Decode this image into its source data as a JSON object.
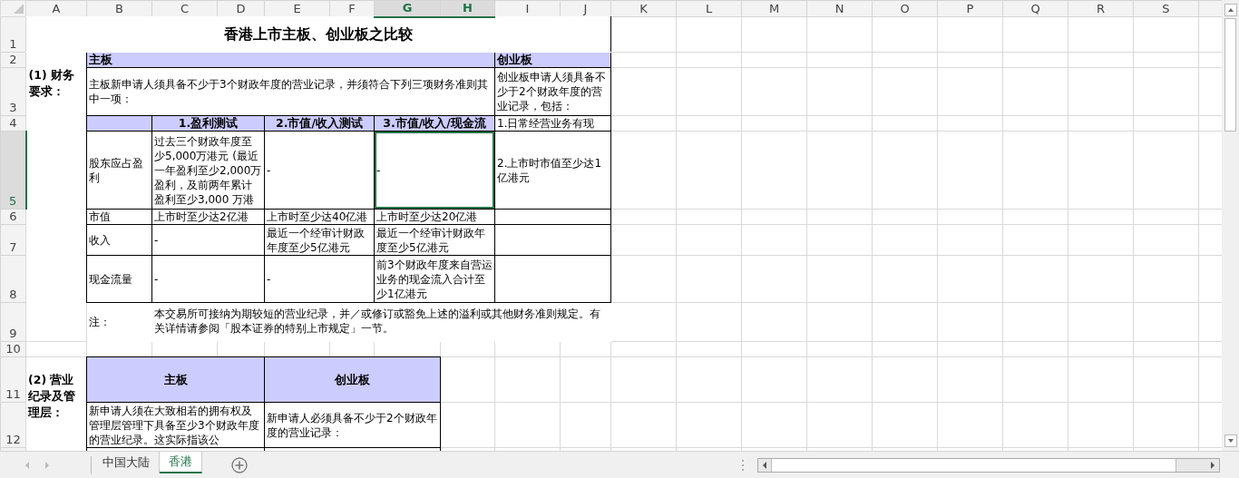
{
  "column_headers": [
    {
      "label": "A",
      "selected": false
    },
    {
      "label": "B",
      "selected": false
    },
    {
      "label": "C",
      "selected": false
    },
    {
      "label": "D",
      "selected": false
    },
    {
      "label": "E",
      "selected": false
    },
    {
      "label": "F",
      "selected": false
    },
    {
      "label": "G",
      "selected": true
    },
    {
      "label": "H",
      "selected": true
    },
    {
      "label": "I",
      "selected": false
    },
    {
      "label": "J",
      "selected": false
    },
    {
      "label": "K",
      "selected": false
    },
    {
      "label": "L",
      "selected": false
    },
    {
      "label": "M",
      "selected": false
    },
    {
      "label": "N",
      "selected": false
    },
    {
      "label": "O",
      "selected": false
    },
    {
      "label": "P",
      "selected": false
    },
    {
      "label": "Q",
      "selected": false
    },
    {
      "label": "R",
      "selected": false
    },
    {
      "label": "S",
      "selected": false
    }
  ],
  "row_headers": [
    {
      "label": "1",
      "selected": false
    },
    {
      "label": "2",
      "selected": false
    },
    {
      "label": "3",
      "selected": false
    },
    {
      "label": "4",
      "selected": false
    },
    {
      "label": "5",
      "selected": true
    },
    {
      "label": "6",
      "selected": false
    },
    {
      "label": "7",
      "selected": false
    },
    {
      "label": "8",
      "selected": false
    },
    {
      "label": "9",
      "selected": false
    },
    {
      "label": "10",
      "selected": false
    },
    {
      "label": "11",
      "selected": false
    },
    {
      "label": "12",
      "selected": false
    }
  ],
  "title": "香港上市主板、创业板之比较",
  "section_1": {
    "label": "(1) 财务要求：",
    "main_board_header": "主板",
    "gem_header": "创业板",
    "main_board_intro": "主板新申请人须具备不少于3个财政年度的营业记录，并须符合下列三项财务准则其中一项：",
    "gem_intro": "创业板申请人须具备不少于2个财政年度的营业记录，包括：",
    "test_headers": [
      "1.盈利测试",
      "2.市值/收入测试",
      "3.市值/收入/现金流"
    ],
    "gem_items": [
      "1.日常经营业务有现",
      "2.上市时市值至少达1亿港元"
    ],
    "criteria": [
      {
        "name": "股东应占盈利",
        "values": [
          {
            "text": "过去三个财政年度至少5,000万港元 (最近一年盈利至少2,000万盈利，及前两年累计盈利至少3,000 万港",
            "selected": false
          },
          {
            "text": "-",
            "selected": false
          },
          {
            "text": "-",
            "selected": true
          }
        ]
      },
      {
        "name": "市值",
        "values": [
          {
            "text": "上市时至少达2亿港",
            "selected": false
          },
          {
            "text": "上市时至少达40亿港",
            "selected": false
          },
          {
            "text": "上市时至少达20亿港",
            "selected": false
          }
        ]
      },
      {
        "name": "收入",
        "values": [
          {
            "text": "-",
            "selected": false
          },
          {
            "text": "最近一个经审计财政年度至少5亿港元",
            "selected": false
          },
          {
            "text": "最近一个经审计财政年度至少5亿港元",
            "selected": false
          }
        ]
      },
      {
        "name": "现金流量",
        "values": [
          {
            "text": "-",
            "selected": false
          },
          {
            "text": "-",
            "selected": false
          },
          {
            "text": "前3个财政年度来自营运业务的现金流入合计至少1亿港元",
            "selected": false
          }
        ]
      }
    ],
    "note_label": "注：",
    "note": "本交易所可接纳为期较短的营业纪录，并／或修订或豁免上述的溢利或其他财务准则规定。有关详情请参阅「股本证券的特别上市规定」一节。"
  },
  "section_2": {
    "label": "(2) 营业纪录及管理层：",
    "headers": [
      "主板",
      "创业板"
    ],
    "texts": [
      "新申请人须在大致相若的拥有权及管理层管理下具备至少3个财政年度的营业纪录。这实际指该公",
      "新申请人必须具备不少于2个财政年度的营业记录："
    ]
  },
  "sheet_tabs": [
    {
      "label": "中国大陆",
      "selected": false
    },
    {
      "label": "香港",
      "selected": true
    }
  ]
}
